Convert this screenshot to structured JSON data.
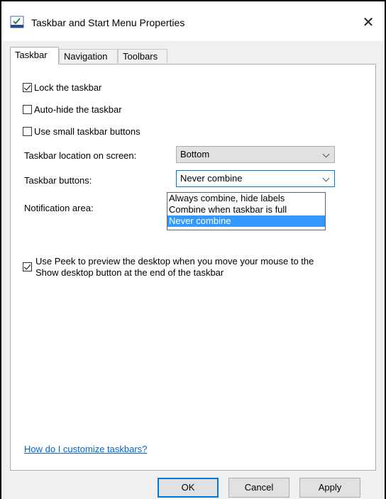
{
  "window": {
    "title": "Taskbar and Start Menu Properties",
    "close_glyph": "✕"
  },
  "tabs": [
    {
      "label": "Taskbar",
      "active": true
    },
    {
      "label": "Navigation",
      "active": false
    },
    {
      "label": "Toolbars",
      "active": false
    }
  ],
  "options": {
    "lock": {
      "label": "Lock the taskbar",
      "checked": true
    },
    "autohide": {
      "label": "Auto-hide the taskbar",
      "checked": false
    },
    "small": {
      "label": "Use small taskbar buttons",
      "checked": false
    }
  },
  "location": {
    "label": "Taskbar location on screen:",
    "value": "Bottom"
  },
  "buttons": {
    "label": "Taskbar buttons:",
    "value": "Never combine",
    "options": [
      "Always combine, hide labels",
      "Combine when taskbar is full",
      "Never combine"
    ],
    "selected_index": 2
  },
  "notification": {
    "label": "Notification area:"
  },
  "peek": {
    "line1": "Use Peek to preview the desktop when you move your mouse to the",
    "line2": "Show desktop button at the end of the taskbar",
    "checked": true
  },
  "help_link": "How do I customize taskbars?",
  "footer": {
    "ok": "OK",
    "cancel": "Cancel",
    "apply": "Apply"
  },
  "colors": {
    "accent": "#0078d7",
    "selection": "#3399ff",
    "link": "#0066cc"
  }
}
